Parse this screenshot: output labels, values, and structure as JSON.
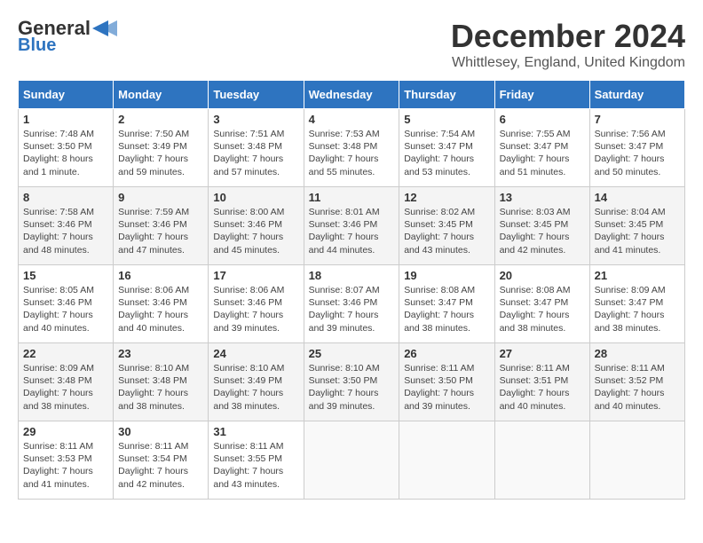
{
  "header": {
    "logo_line1": "General",
    "logo_line2": "Blue",
    "month_title": "December 2024",
    "subtitle": "Whittlesey, England, United Kingdom"
  },
  "columns": [
    "Sunday",
    "Monday",
    "Tuesday",
    "Wednesday",
    "Thursday",
    "Friday",
    "Saturday"
  ],
  "weeks": [
    [
      {
        "day": "1",
        "content": "Sunrise: 7:48 AM\nSunset: 3:50 PM\nDaylight: 8 hours\nand 1 minute."
      },
      {
        "day": "2",
        "content": "Sunrise: 7:50 AM\nSunset: 3:49 PM\nDaylight: 7 hours\nand 59 minutes."
      },
      {
        "day": "3",
        "content": "Sunrise: 7:51 AM\nSunset: 3:48 PM\nDaylight: 7 hours\nand 57 minutes."
      },
      {
        "day": "4",
        "content": "Sunrise: 7:53 AM\nSunset: 3:48 PM\nDaylight: 7 hours\nand 55 minutes."
      },
      {
        "day": "5",
        "content": "Sunrise: 7:54 AM\nSunset: 3:47 PM\nDaylight: 7 hours\nand 53 minutes."
      },
      {
        "day": "6",
        "content": "Sunrise: 7:55 AM\nSunset: 3:47 PM\nDaylight: 7 hours\nand 51 minutes."
      },
      {
        "day": "7",
        "content": "Sunrise: 7:56 AM\nSunset: 3:47 PM\nDaylight: 7 hours\nand 50 minutes."
      }
    ],
    [
      {
        "day": "8",
        "content": "Sunrise: 7:58 AM\nSunset: 3:46 PM\nDaylight: 7 hours\nand 48 minutes."
      },
      {
        "day": "9",
        "content": "Sunrise: 7:59 AM\nSunset: 3:46 PM\nDaylight: 7 hours\nand 47 minutes."
      },
      {
        "day": "10",
        "content": "Sunrise: 8:00 AM\nSunset: 3:46 PM\nDaylight: 7 hours\nand 45 minutes."
      },
      {
        "day": "11",
        "content": "Sunrise: 8:01 AM\nSunset: 3:46 PM\nDaylight: 7 hours\nand 44 minutes."
      },
      {
        "day": "12",
        "content": "Sunrise: 8:02 AM\nSunset: 3:45 PM\nDaylight: 7 hours\nand 43 minutes."
      },
      {
        "day": "13",
        "content": "Sunrise: 8:03 AM\nSunset: 3:45 PM\nDaylight: 7 hours\nand 42 minutes."
      },
      {
        "day": "14",
        "content": "Sunrise: 8:04 AM\nSunset: 3:45 PM\nDaylight: 7 hours\nand 41 minutes."
      }
    ],
    [
      {
        "day": "15",
        "content": "Sunrise: 8:05 AM\nSunset: 3:46 PM\nDaylight: 7 hours\nand 40 minutes."
      },
      {
        "day": "16",
        "content": "Sunrise: 8:06 AM\nSunset: 3:46 PM\nDaylight: 7 hours\nand 40 minutes."
      },
      {
        "day": "17",
        "content": "Sunrise: 8:06 AM\nSunset: 3:46 PM\nDaylight: 7 hours\nand 39 minutes."
      },
      {
        "day": "18",
        "content": "Sunrise: 8:07 AM\nSunset: 3:46 PM\nDaylight: 7 hours\nand 39 minutes."
      },
      {
        "day": "19",
        "content": "Sunrise: 8:08 AM\nSunset: 3:47 PM\nDaylight: 7 hours\nand 38 minutes."
      },
      {
        "day": "20",
        "content": "Sunrise: 8:08 AM\nSunset: 3:47 PM\nDaylight: 7 hours\nand 38 minutes."
      },
      {
        "day": "21",
        "content": "Sunrise: 8:09 AM\nSunset: 3:47 PM\nDaylight: 7 hours\nand 38 minutes."
      }
    ],
    [
      {
        "day": "22",
        "content": "Sunrise: 8:09 AM\nSunset: 3:48 PM\nDaylight: 7 hours\nand 38 minutes."
      },
      {
        "day": "23",
        "content": "Sunrise: 8:10 AM\nSunset: 3:48 PM\nDaylight: 7 hours\nand 38 minutes."
      },
      {
        "day": "24",
        "content": "Sunrise: 8:10 AM\nSunset: 3:49 PM\nDaylight: 7 hours\nand 38 minutes."
      },
      {
        "day": "25",
        "content": "Sunrise: 8:10 AM\nSunset: 3:50 PM\nDaylight: 7 hours\nand 39 minutes."
      },
      {
        "day": "26",
        "content": "Sunrise: 8:11 AM\nSunset: 3:50 PM\nDaylight: 7 hours\nand 39 minutes."
      },
      {
        "day": "27",
        "content": "Sunrise: 8:11 AM\nSunset: 3:51 PM\nDaylight: 7 hours\nand 40 minutes."
      },
      {
        "day": "28",
        "content": "Sunrise: 8:11 AM\nSunset: 3:52 PM\nDaylight: 7 hours\nand 40 minutes."
      }
    ],
    [
      {
        "day": "29",
        "content": "Sunrise: 8:11 AM\nSunset: 3:53 PM\nDaylight: 7 hours\nand 41 minutes."
      },
      {
        "day": "30",
        "content": "Sunrise: 8:11 AM\nSunset: 3:54 PM\nDaylight: 7 hours\nand 42 minutes."
      },
      {
        "day": "31",
        "content": "Sunrise: 8:11 AM\nSunset: 3:55 PM\nDaylight: 7 hours\nand 43 minutes."
      },
      {
        "day": "",
        "content": ""
      },
      {
        "day": "",
        "content": ""
      },
      {
        "day": "",
        "content": ""
      },
      {
        "day": "",
        "content": ""
      }
    ]
  ]
}
